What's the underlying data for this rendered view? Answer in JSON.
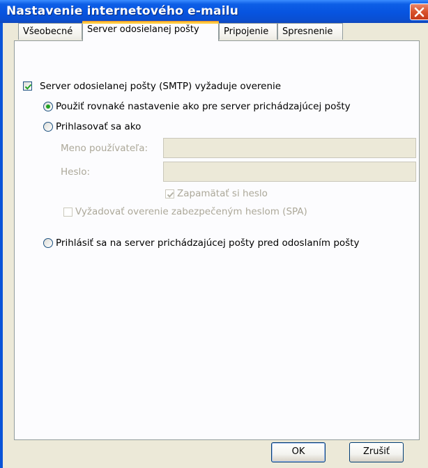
{
  "window": {
    "title": "Nastavenie internetového e-mailu"
  },
  "tabs": [
    {
      "label": "Všeobecné",
      "active": false
    },
    {
      "label": "Server odosielanej pošty",
      "active": true
    },
    {
      "label": "Pripojenie",
      "active": false
    },
    {
      "label": "Spresnenie",
      "active": false
    }
  ],
  "outgoing": {
    "smtp_auth_label": "Server odosielanej pošty (SMTP) vyžaduje overenie",
    "smtp_auth_checked": true,
    "use_same_label": "Použiť rovnaké nastavenie ako pre server prichádzajúcej pošty",
    "use_same_selected": true,
    "login_as_label": "Prihlasovať sa ako",
    "username_label": "Meno používateľa:",
    "username_value": "",
    "password_label": "Heslo:",
    "password_value": "",
    "remember_password_label": "Zapamätať si heslo",
    "remember_password_checked": true,
    "spa_label": "Vyžadovať overenie zabezpečeným heslom (SPA)",
    "spa_checked": false,
    "login_before_send_label": "Prihlásiť sa na server prichádzajúcej pošty pred odoslaním pošty"
  },
  "buttons": {
    "ok": "OK",
    "cancel": "Zrušiť"
  },
  "colors": {
    "titlebar": "#0754e0",
    "window_face": "#ece9d8",
    "radio_dot": "#21a121",
    "active_tab_accent": "#ffc83c",
    "close_button": "#d9522c"
  }
}
